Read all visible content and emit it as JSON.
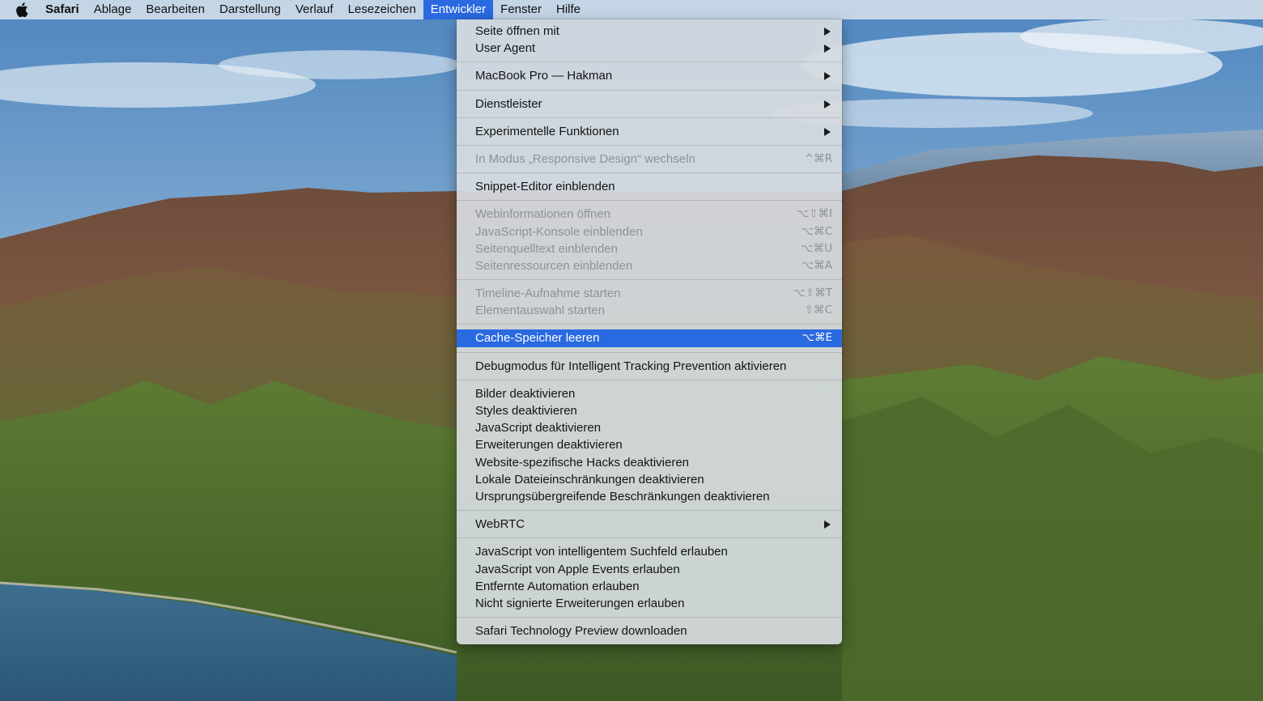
{
  "menubar": {
    "apple_icon": "apple-logo-icon",
    "items": [
      {
        "label": "Safari"
      },
      {
        "label": "Ablage"
      },
      {
        "label": "Bearbeiten"
      },
      {
        "label": "Darstellung"
      },
      {
        "label": "Verlauf"
      },
      {
        "label": "Lesezeichen"
      },
      {
        "label": "Entwickler"
      },
      {
        "label": "Fenster"
      },
      {
        "label": "Hilfe"
      }
    ]
  },
  "menu": {
    "items": [
      {
        "label": "Seite öffnen mit",
        "shortcut": ""
      },
      {
        "label": "User Agent",
        "shortcut": ""
      },
      {
        "label": "MacBook Pro — Hakman",
        "shortcut": ""
      },
      {
        "label": "Dienstleister",
        "shortcut": ""
      },
      {
        "label": "Experimentelle Funktionen",
        "shortcut": ""
      },
      {
        "label": "In Modus „Responsive Design“ wechseln",
        "shortcut": "^⌘R"
      },
      {
        "label": "Snippet-Editor einblenden",
        "shortcut": ""
      },
      {
        "label": "Webinformationen öffnen",
        "shortcut": "⌥⇧⌘I"
      },
      {
        "label": "JavaScript-Konsole einblenden",
        "shortcut": "⌥⌘C"
      },
      {
        "label": "Seitenquelltext einblenden",
        "shortcut": "⌥⌘U"
      },
      {
        "label": "Seitenressourcen einblenden",
        "shortcut": "⌥⌘A"
      },
      {
        "label": "Timeline-Aufnahme starten",
        "shortcut": "⌥⇧⌘T"
      },
      {
        "label": "Elementauswahl starten",
        "shortcut": "⇧⌘C"
      },
      {
        "label": "Cache-Speicher leeren",
        "shortcut": "⌥⌘E"
      },
      {
        "label": "Debugmodus für Intelligent Tracking Prevention aktivieren",
        "shortcut": ""
      },
      {
        "label": "Bilder deaktivieren",
        "shortcut": ""
      },
      {
        "label": "Styles deaktivieren",
        "shortcut": ""
      },
      {
        "label": "JavaScript deaktivieren",
        "shortcut": ""
      },
      {
        "label": "Erweiterungen deaktivieren",
        "shortcut": ""
      },
      {
        "label": "Website-spezifische Hacks deaktivieren",
        "shortcut": ""
      },
      {
        "label": "Lokale Dateieinschränkungen deaktivieren",
        "shortcut": ""
      },
      {
        "label": "Ursprungsübergreifende Beschränkungen deaktivieren",
        "shortcut": ""
      },
      {
        "label": "WebRTC",
        "shortcut": ""
      },
      {
        "label": "JavaScript von intelligentem Suchfeld erlauben",
        "shortcut": ""
      },
      {
        "label": "JavaScript von Apple Events erlauben",
        "shortcut": ""
      },
      {
        "label": "Entfernte Automation erlauben",
        "shortcut": ""
      },
      {
        "label": "Nicht signierte Erweiterungen erlauben",
        "shortcut": ""
      },
      {
        "label": "Safari Technology Preview downloaden",
        "shortcut": ""
      }
    ]
  },
  "colors": {
    "highlight": "#2a6ae0",
    "menu_background": "#d6dbe0",
    "disabled_text": "#8e9196"
  }
}
